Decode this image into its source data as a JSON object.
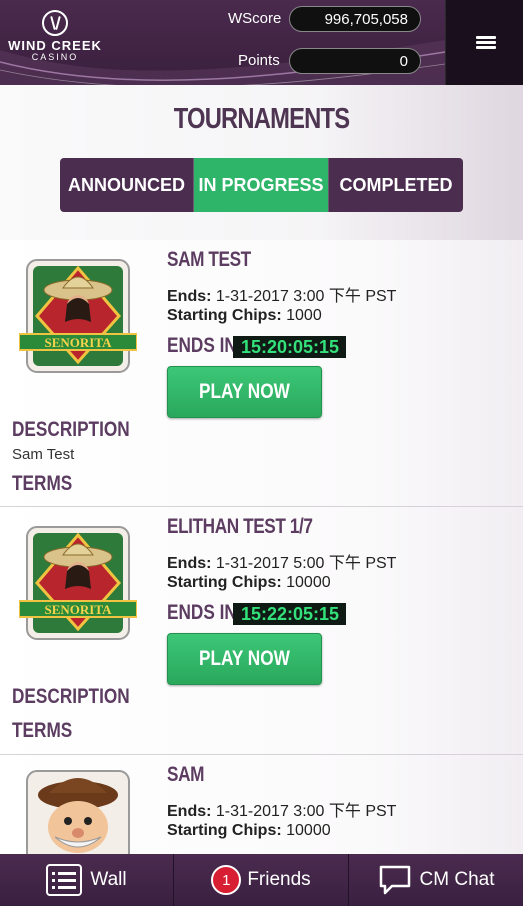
{
  "header": {
    "logo_text": "WIND CREEK",
    "logo_sub": "CASINO",
    "wscore_label": "WScore",
    "wscore_value": "996,705,058",
    "points_label": "Points",
    "points_value": "0",
    "menu_icon": "hamburger-menu-icon"
  },
  "page": {
    "title": "TOURNAMENTS",
    "tabs": [
      {
        "label": "ANNOUNCED",
        "active": false
      },
      {
        "label": "IN PROGRESS",
        "active": true
      },
      {
        "label": "COMPLETED",
        "active": false
      }
    ]
  },
  "tournaments": [
    {
      "name": "SAM TEST",
      "ends_label": "Ends:",
      "ends_value": "1-31-2017 3:00 下午 PST",
      "chips_label": "Starting Chips:",
      "chips_value": "1000",
      "ends_in_label": "ENDS IN:",
      "timer": "15:20:05:15",
      "play_label": "PLAY NOW",
      "description_heading": "DESCRIPTION",
      "description": "Sam Test",
      "terms_heading": "TERMS",
      "game_icon": "senorita-slot-icon"
    },
    {
      "name": "ELITHAN TEST 1/7",
      "ends_label": "Ends:",
      "ends_value": "1-31-2017 5:00 下午 PST",
      "chips_label": "Starting Chips:",
      "chips_value": "10000",
      "ends_in_label": "ENDS IN:",
      "timer": "15:22:05:15",
      "play_label": "PLAY NOW",
      "description_heading": "DESCRIPTION",
      "description": "",
      "terms_heading": "TERMS",
      "game_icon": "senorita-slot-icon"
    },
    {
      "name": "SAM",
      "ends_label": "Ends:",
      "ends_value": "1-31-2017 3:00 下午 PST",
      "chips_label": "Starting Chips:",
      "chips_value": "10000",
      "game_icon": "luck-slot-icon"
    }
  ],
  "bottom_bar": {
    "wall_label": "Wall",
    "friends_label": "Friends",
    "friends_badge": "1",
    "chat_label": "CM Chat"
  },
  "colors": {
    "header_purple": "#3a1f3e",
    "accent_green": "#2fb56a",
    "heading_purple": "#5c3d61",
    "timer_text": "#33e07a",
    "badge_red": "#d81e32"
  }
}
